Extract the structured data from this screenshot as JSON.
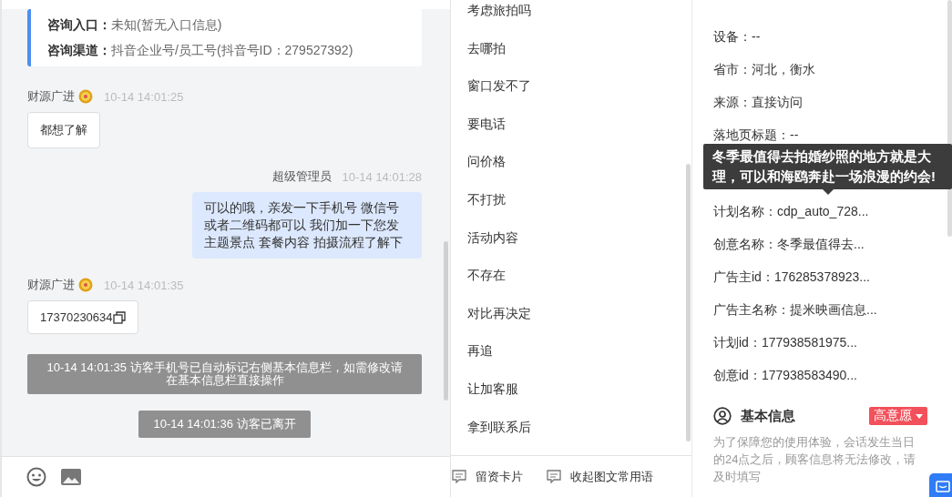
{
  "chat": {
    "entry_card": [
      {
        "label": "咨询入口：",
        "value": "未知(暂无入口信息)"
      },
      {
        "label": "咨询渠道：",
        "value": "抖音企业号/员工号(抖音号ID：279527392)"
      }
    ],
    "messages": [
      {
        "kind": "incoming",
        "sender": "财源广进",
        "time": "10-14 14:01:25",
        "text": "都想了解",
        "copyable": false
      },
      {
        "kind": "outgoing",
        "sender": "超级管理员",
        "time": "10-14 14:01:28",
        "text": "可以的哦，亲发一下手机号 微信号或者二维码都可以 我们加一下您发主题景点 套餐内容 拍摄流程了解下"
      },
      {
        "kind": "incoming",
        "sender": "财源广进",
        "time": "10-14 14:01:35",
        "text": "17370230634",
        "copyable": true
      },
      {
        "kind": "system",
        "text": "10-14 14:01:35 访客手机号已自动标记右侧基本信息栏，如需修改请在基本信息栏直接操作"
      },
      {
        "kind": "system",
        "text": "10-14 14:01:36 访客已离开"
      }
    ]
  },
  "phrases": {
    "items": [
      "考虑旅拍吗",
      "去哪拍",
      "窗口发不了",
      "要电话",
      "问价格",
      "不打扰",
      "活动内容",
      "不存在",
      "对比再决定",
      "再追",
      "让加客服",
      "拿到联系后"
    ],
    "actions": [
      "留资卡片",
      "收起图文常用语"
    ]
  },
  "info": {
    "fields_above_tooltip": [
      "设备：--",
      "省市：河北，衡水",
      "来源：直接访问",
      "落地页标题：--"
    ],
    "tooltip": "冬季最值得去拍婚纱照的地方就是大理，可以和海鸥奔赴一场浪漫的约会!",
    "fields_below_tooltip": [
      "计划名称：cdp_auto_728...",
      "创意名称：冬季最值得去...",
      "广告主id：176285378923...",
      "广告主名称：提米映画信息...",
      "计划id：177938581975...",
      "创意id：177938583490..."
    ],
    "basic_title": "基本信息",
    "intent_tag": "高意愿",
    "notice": "为了保障您的使用体验，会话发生当日的24点之后，顾客信息将无法修改，请及时填写"
  }
}
